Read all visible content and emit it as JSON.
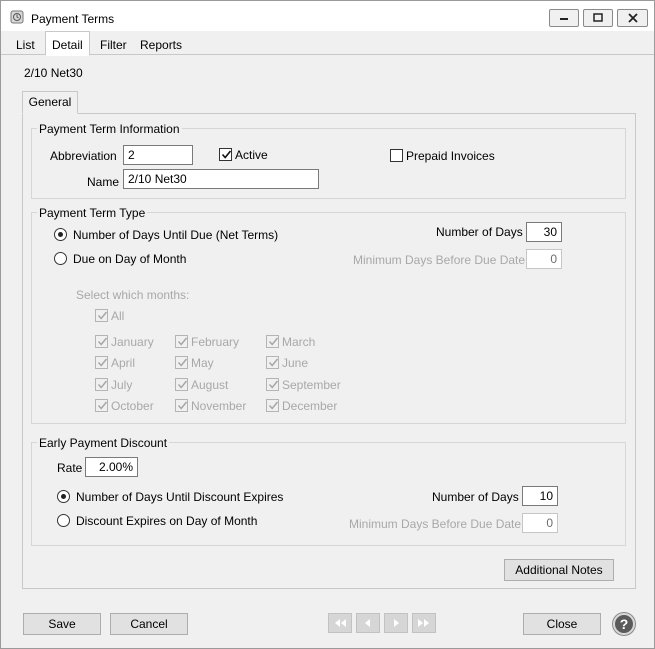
{
  "window": {
    "title": "Payment Terms",
    "minimize_icon": "minimize-icon",
    "maximize_icon": "maximize-icon",
    "close_icon": "close-icon"
  },
  "tabs": [
    {
      "label": "List"
    },
    {
      "label": "Detail",
      "active": true
    },
    {
      "label": "Filter"
    },
    {
      "label": "Reports"
    }
  ],
  "record_title": "2/10 Net30",
  "inner_tab": "General",
  "term_info": {
    "group_label": "Payment Term Information",
    "abbreviation_label": "Abbreviation",
    "abbreviation_value": "2",
    "active_label": "Active",
    "active_checked": true,
    "prepaid_label": "Prepaid Invoices",
    "prepaid_checked": false,
    "name_label": "Name",
    "name_value": "2/10 Net30"
  },
  "term_type": {
    "group_label": "Payment Term Type",
    "option_net": "Number of Days Until Due (Net Terms)",
    "option_day_of_month": "Due on Day of Month",
    "selected": "net",
    "number_of_days_label": "Number of Days",
    "number_of_days_value": "30",
    "min_days_label": "Minimum Days Before Due Date",
    "min_days_value": "0",
    "months_prompt": "Select which months:",
    "all_label": "All",
    "months": [
      "January",
      "February",
      "March",
      "April",
      "May",
      "June",
      "July",
      "August",
      "September",
      "October",
      "November",
      "December"
    ]
  },
  "discount": {
    "group_label": "Early Payment Discount",
    "rate_label": "Rate",
    "rate_value": "2.00%",
    "option_days": "Number of Days Until Discount Expires",
    "option_day_of_month": "Discount Expires on Day of Month",
    "selected": "days",
    "number_of_days_label": "Number of Days",
    "number_of_days_value": "10",
    "min_days_label": "Minimum Days Before Due Date",
    "min_days_value": "0"
  },
  "additional_notes_label": "Additional Notes",
  "footer": {
    "save_label": "Save",
    "cancel_label": "Cancel",
    "close_label": "Close",
    "help_glyph": "?",
    "nav_icons": [
      "first-record-icon",
      "previous-record-icon",
      "next-record-icon",
      "last-record-icon"
    ]
  }
}
